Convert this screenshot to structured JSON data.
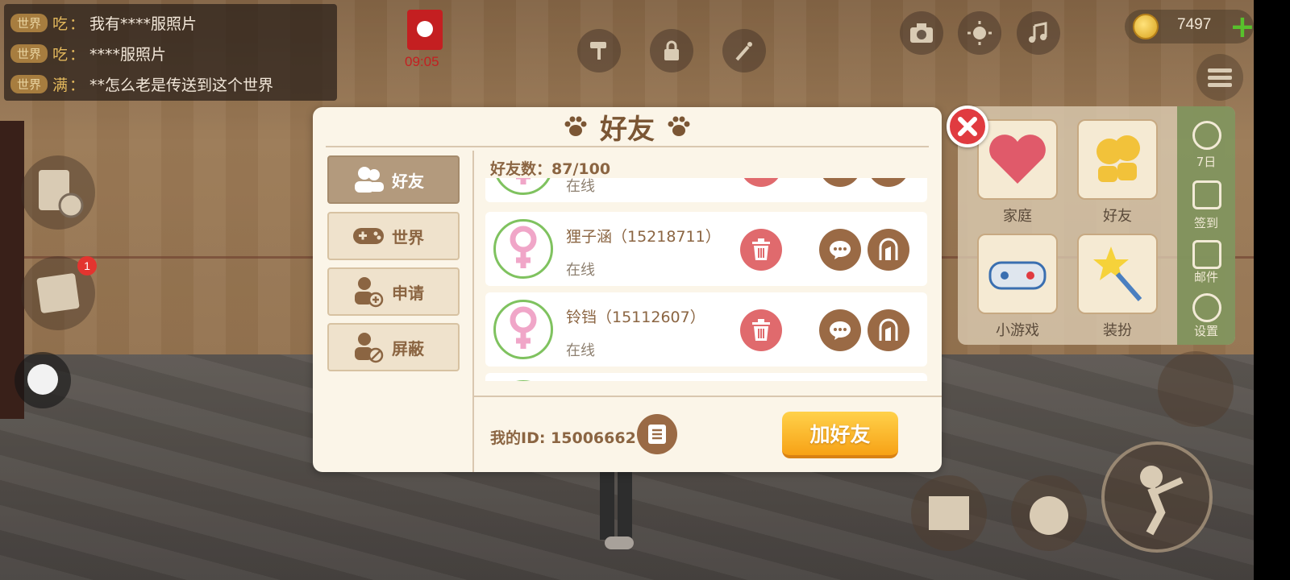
{
  "chat": {
    "lines": [
      {
        "channel": "世界",
        "name": "吃",
        "sep": "：",
        "text": "我有****服照片"
      },
      {
        "channel": "世界",
        "name": "吃",
        "sep": "：",
        "text": "****服照片"
      },
      {
        "channel": "世界",
        "name": "满",
        "sep": "：",
        "text": "**怎么老是传送到这个世界"
      }
    ]
  },
  "hud": {
    "redpack_time": "09:05",
    "coins": "7497",
    "notification_badge": "1"
  },
  "right_panel": {
    "cards": [
      {
        "label": "家庭",
        "icon": "heart-icon"
      },
      {
        "label": "好友",
        "icon": "friends-icon"
      },
      {
        "label": "小游戏",
        "icon": "gamepad-icon"
      },
      {
        "label": "装扮",
        "icon": "magic-wand-icon"
      }
    ],
    "strip": [
      {
        "label": "7日",
        "icon": "7day-icon"
      },
      {
        "label": "签到",
        "icon": "checkin-icon"
      },
      {
        "label": "邮件",
        "icon": "mail-icon"
      },
      {
        "label": "设置",
        "icon": "gear-icon"
      }
    ]
  },
  "dialog": {
    "title": "好友",
    "tabs": [
      {
        "label": "好友",
        "icon": "friends-icon",
        "active": true
      },
      {
        "label": "世界",
        "icon": "gamepad-icon",
        "active": false
      },
      {
        "label": "申请",
        "icon": "add-user-icon",
        "active": false
      },
      {
        "label": "屏蔽",
        "icon": "block-user-icon",
        "active": false
      }
    ],
    "friend_count_label": "好友数：87/100",
    "friends": [
      {
        "name": "",
        "status": "在线",
        "gender": "female"
      },
      {
        "name": "狸子涵（15218711）",
        "status": "在线",
        "gender": "female"
      },
      {
        "name": "铃铛（15112607）",
        "status": "在线",
        "gender": "female"
      },
      {
        "name": "",
        "status": "",
        "gender": "female"
      }
    ],
    "my_id_label": "我的ID:  15006662",
    "add_friend_label": "加好友"
  },
  "colors": {
    "accent_brown": "#8b6542",
    "online_ring": "#7fc25f",
    "delete_red": "#e06a6d",
    "add_orange": "#f7a216",
    "close_red": "#e03b40"
  }
}
